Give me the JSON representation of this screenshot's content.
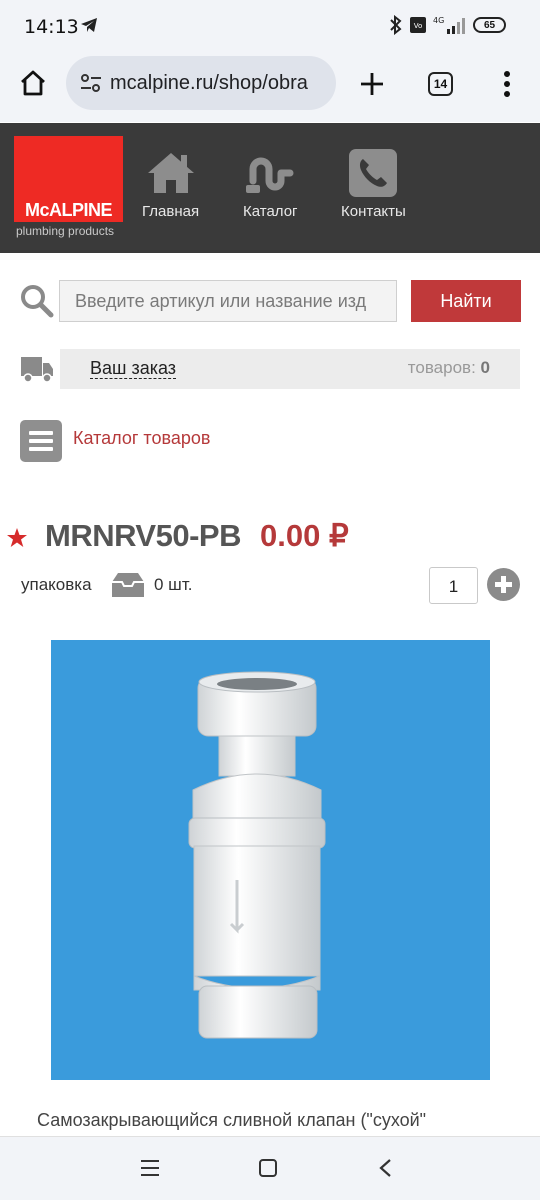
{
  "status_bar": {
    "time": "14:13",
    "battery": "65"
  },
  "browser": {
    "url": "mcalpine.ru/shop/obra",
    "tab_count": "14"
  },
  "site": {
    "logo_text": "McALPINE",
    "logo_sub": "plumbing products",
    "nav": [
      {
        "label": "Главная",
        "icon": "home-icon"
      },
      {
        "label": "Каталог",
        "icon": "siphon-icon"
      },
      {
        "label": "Контакты",
        "icon": "phone-icon"
      }
    ]
  },
  "search": {
    "placeholder": "Введите артикул или название изд",
    "button": "Найти"
  },
  "order": {
    "link": "Ваш заказ",
    "count_label": "товаров:",
    "count": "0"
  },
  "catalog": {
    "label": "Каталог товаров"
  },
  "product": {
    "sku": "MRNRV50-PB",
    "price": "0.00 ₽",
    "pack_label": "упаковка",
    "pack_qty": "0 шт.",
    "quantity": "1",
    "description": "Самозакрывающийся сливной клапан (\"сухой\""
  },
  "colors": {
    "accent": "#c0393a",
    "header_bg": "#3a3a3a",
    "logo_red": "#ee2a24",
    "image_bg": "#3a9bdc"
  }
}
